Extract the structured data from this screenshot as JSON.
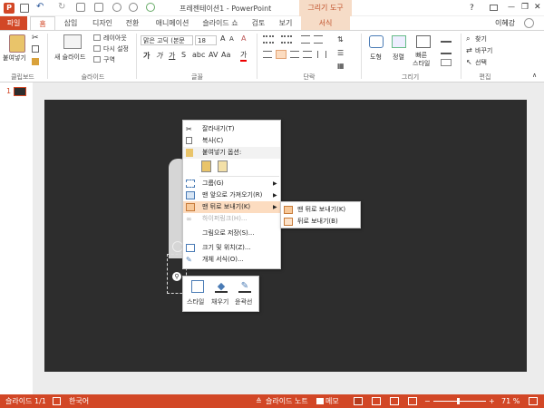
{
  "titlebar": {
    "title": "프레젠테이션1 - PowerPoint",
    "context_tool": "그리기 도구",
    "help": "?",
    "minimize": "—",
    "restore": "❐",
    "close": "✕"
  },
  "tabs": [
    {
      "label": "파일"
    },
    {
      "label": "홈"
    },
    {
      "label": "삽입"
    },
    {
      "label": "디자인"
    },
    {
      "label": "전환"
    },
    {
      "label": "애니메이션"
    },
    {
      "label": "슬라이드 쇼"
    },
    {
      "label": "검토"
    },
    {
      "label": "보기"
    },
    {
      "label": "서식"
    }
  ],
  "user": "이혜강",
  "ribbon": {
    "clipboard": {
      "paste": "붙여넣기",
      "label": "클립보드"
    },
    "slides": {
      "new_slide": "새 슬라이드",
      "layout": "레이아웃",
      "reset": "다시 설정",
      "section": "구역",
      "label": "슬라이드"
    },
    "font": {
      "name": "맑은 고딕 (본문",
      "size": "18",
      "label": "글꼴"
    },
    "paragraph": {
      "label": "단락"
    },
    "drawing": {
      "shape": "도형",
      "arrange": "정렬",
      "quick_style": "빠른\n스타일",
      "label": "그리기"
    },
    "editing": {
      "find": "찾기",
      "replace": "바꾸기",
      "select": "선택",
      "label": "편집"
    }
  },
  "thumbnails": [
    {
      "number": "1"
    }
  ],
  "context_menu": {
    "items": [
      {
        "label": "잘라내기(T)",
        "icon": "scissors-icon",
        "disabled": false
      },
      {
        "label": "복사(C)",
        "icon": "copy-icon",
        "disabled": false
      },
      {
        "label": "붙여넣기 옵션:",
        "icon": "paste-icon",
        "disabled": false
      },
      {
        "label": "그룹(G)",
        "icon": "group-icon",
        "disabled": false,
        "submenu": true
      },
      {
        "label": "맨 앞으로 가져오기(R)",
        "icon": "bring-front-icon",
        "disabled": false,
        "submenu": true
      },
      {
        "label": "맨 뒤로 보내기(K)",
        "icon": "send-back-icon",
        "disabled": false,
        "submenu": true,
        "highlight": true
      },
      {
        "label": "하이퍼링크(H)...",
        "icon": "hyperlink-icon",
        "disabled": true
      },
      {
        "label": "그림으로 저장(S)...",
        "icon": "",
        "disabled": false
      },
      {
        "label": "크기 및 위치(Z)...",
        "icon": "size-position-icon",
        "disabled": false
      },
      {
        "label": "개체 서식(O)...",
        "icon": "format-object-icon",
        "disabled": false
      }
    ],
    "submenu": [
      {
        "label": "맨 뒤로 보내기(K)",
        "icon": "send-to-back-icon"
      },
      {
        "label": "뒤로 보내기(B)",
        "icon": "send-backward-icon"
      }
    ]
  },
  "mini_toolbar": {
    "style": "스타일",
    "fill": "채우기",
    "outline": "윤곽선"
  },
  "statusbar": {
    "slide": "슬라이드 1/1",
    "language": "한국어",
    "notes": "슬라이드 노트",
    "comments": "메모",
    "zoom": "71 %"
  },
  "colors": {
    "accent": "#d24726",
    "context_tab": "#f6dcc7",
    "slide_bg": "#2d2d2d",
    "highlight": "#fcdcc0"
  }
}
